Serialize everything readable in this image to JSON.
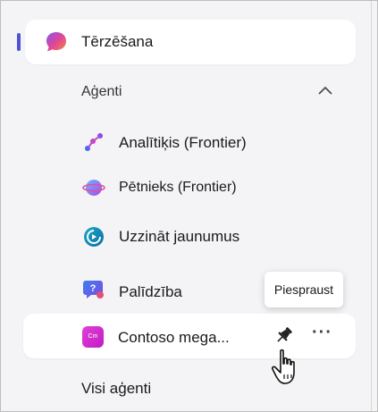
{
  "chat": {
    "label": "Tērzēšana"
  },
  "agents_section": {
    "header": "Aģenti"
  },
  "agents": [
    {
      "label": "Analītiķis (Frontier)",
      "icon": "analyst-icon"
    },
    {
      "label": "Pētnieks (Frontier)",
      "icon": "researcher-icon"
    },
    {
      "label": "Uzzināt jaunumus",
      "icon": "catch-up-icon"
    },
    {
      "label": "Palīdzība",
      "icon": "help-icon"
    }
  ],
  "contoso": {
    "label": "Contoso mega...",
    "icon_text": "Cm"
  },
  "tooltip": {
    "text": "Piespraust"
  },
  "footer": {
    "all_agents": "Visi aģenti"
  },
  "colors": {
    "accent": "#4f52d9",
    "background": "#f4f4f6",
    "contoso": "#d12fd0"
  }
}
